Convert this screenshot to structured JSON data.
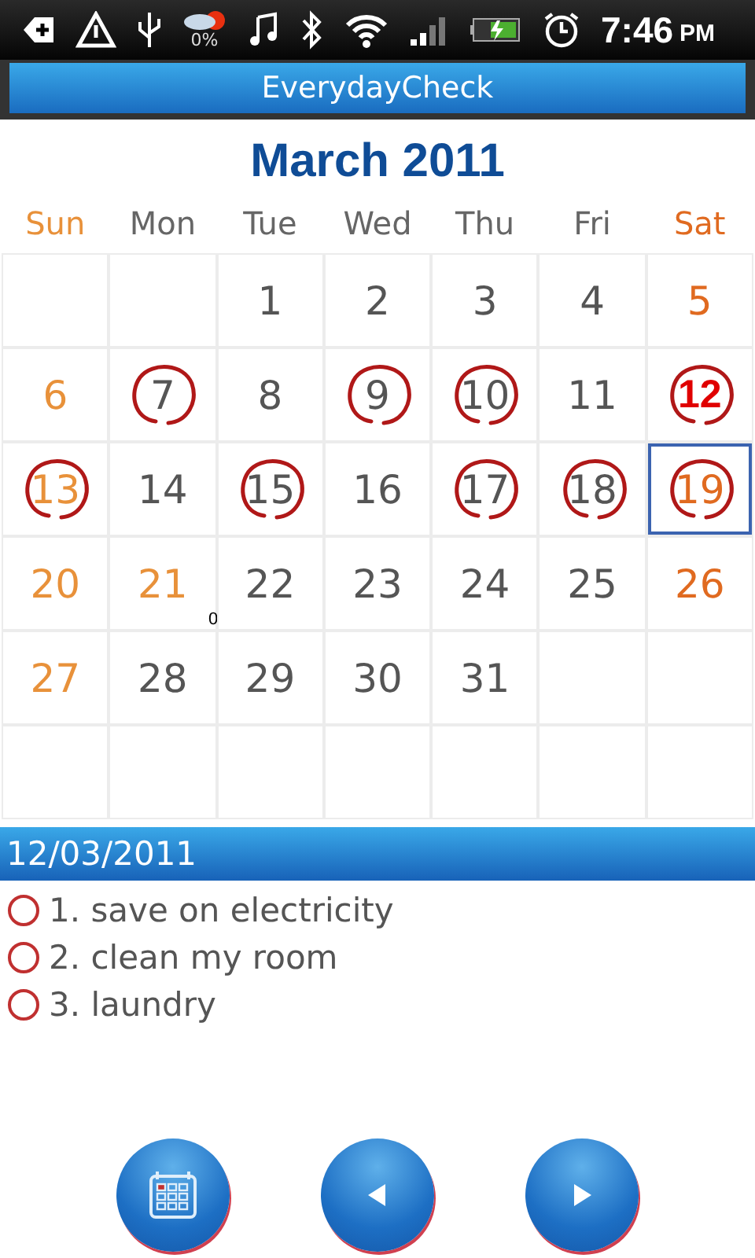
{
  "status_bar": {
    "battery_text": "0%",
    "time": "7:46",
    "meridiem": "PM"
  },
  "window": {
    "title": "EverydayCheck"
  },
  "calendar": {
    "title": "March 2011",
    "weekdays": [
      {
        "label": "Sun",
        "color": "#e8913a"
      },
      {
        "label": "Mon",
        "color": "#666666"
      },
      {
        "label": "Tue",
        "color": "#666666"
      },
      {
        "label": "Wed",
        "color": "#666666"
      },
      {
        "label": "Thu",
        "color": "#666666"
      },
      {
        "label": "Fri",
        "color": "#666666"
      },
      {
        "label": "Sat",
        "color": "#e06a20"
      }
    ],
    "weeks": [
      [
        {
          "day": "1",
          "color": "#555555",
          "checked": false,
          "today": false,
          "selected": false
        },
        {
          "day": "2",
          "color": "#555555",
          "checked": false,
          "today": false,
          "selected": false
        },
        {
          "day": "3",
          "color": "#555555",
          "checked": false,
          "today": false,
          "selected": false
        },
        {
          "day": "4",
          "color": "#555555",
          "checked": false,
          "today": false,
          "selected": false
        },
        {
          "day": "5",
          "color": "#e06a20",
          "checked": false,
          "today": false,
          "selected": false
        }
      ],
      [
        {
          "day": "6",
          "color": "#e8913a",
          "checked": false,
          "today": false,
          "selected": false
        },
        {
          "day": "7",
          "color": "#555555",
          "checked": true,
          "today": false,
          "selected": false
        },
        {
          "day": "8",
          "color": "#555555",
          "checked": false,
          "today": false,
          "selected": false
        },
        {
          "day": "9",
          "color": "#555555",
          "checked": true,
          "today": false,
          "selected": false
        },
        {
          "day": "10",
          "color": "#555555",
          "checked": true,
          "today": false,
          "selected": false
        },
        {
          "day": "11",
          "color": "#555555",
          "checked": false,
          "today": false,
          "selected": false
        },
        {
          "day": "12",
          "color": "#e00000",
          "checked": true,
          "today": true,
          "selected": false
        }
      ],
      [
        {
          "day": "13",
          "color": "#e8913a",
          "checked": true,
          "today": false,
          "selected": false
        },
        {
          "day": "14",
          "color": "#555555",
          "checked": false,
          "today": false,
          "selected": false
        },
        {
          "day": "15",
          "color": "#555555",
          "checked": true,
          "today": false,
          "selected": false
        },
        {
          "day": "16",
          "color": "#555555",
          "checked": false,
          "today": false,
          "selected": false
        },
        {
          "day": "17",
          "color": "#555555",
          "checked": true,
          "today": false,
          "selected": false
        },
        {
          "day": "18",
          "color": "#555555",
          "checked": true,
          "today": false,
          "selected": false
        },
        {
          "day": "19",
          "color": "#e06a20",
          "checked": true,
          "today": false,
          "selected": true
        }
      ],
      [
        {
          "day": "20",
          "color": "#e8913a",
          "checked": false,
          "today": false,
          "selected": false
        },
        {
          "day": "21",
          "color": "#e8913a",
          "checked": false,
          "today": false,
          "selected": false,
          "note": "0"
        },
        {
          "day": "22",
          "color": "#555555",
          "checked": false,
          "today": false,
          "selected": false
        },
        {
          "day": "23",
          "color": "#555555",
          "checked": false,
          "today": false,
          "selected": false
        },
        {
          "day": "24",
          "color": "#555555",
          "checked": false,
          "today": false,
          "selected": false
        },
        {
          "day": "25",
          "color": "#555555",
          "checked": false,
          "today": false,
          "selected": false
        },
        {
          "day": "26",
          "color": "#e06a20",
          "checked": false,
          "today": false,
          "selected": false
        }
      ],
      [
        {
          "day": "27",
          "color": "#e8913a",
          "checked": false,
          "today": false,
          "selected": false
        },
        {
          "day": "28",
          "color": "#555555",
          "checked": false,
          "today": false,
          "selected": false
        },
        {
          "day": "29",
          "color": "#555555",
          "checked": false,
          "today": false,
          "selected": false
        },
        {
          "day": "30",
          "color": "#555555",
          "checked": false,
          "today": false,
          "selected": false
        },
        {
          "day": "31",
          "color": "#555555",
          "checked": false,
          "today": false,
          "selected": false
        }
      ]
    ]
  },
  "date_bar": {
    "date": "12/03/2011"
  },
  "tasks": [
    {
      "label": "1. save on electricity",
      "checked": false
    },
    {
      "label": "2. clean my room",
      "checked": false
    },
    {
      "label": "3. laundry",
      "checked": false
    }
  ],
  "buttons": [
    {
      "kind": "calendar"
    },
    {
      "kind": "previous"
    },
    {
      "kind": "next"
    }
  ]
}
